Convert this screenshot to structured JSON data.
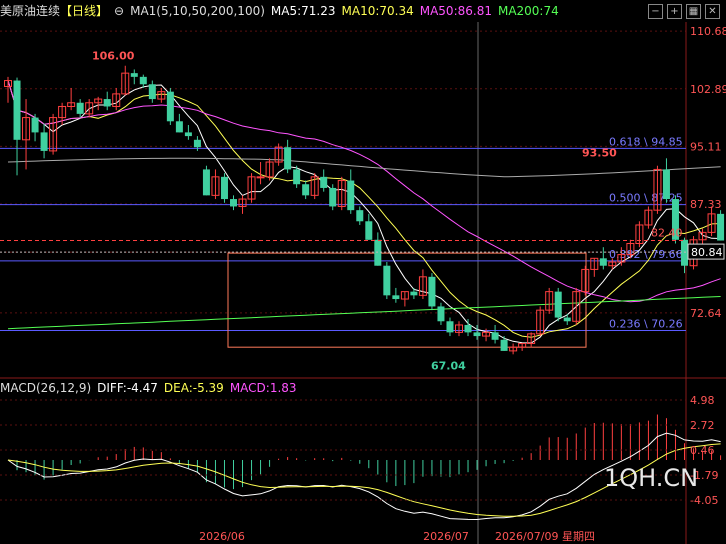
{
  "header": {
    "symbol": "美原油连续",
    "period": "【日线】",
    "ma_label": "MA1(5,10,50,200,100)",
    "ma5": "MA5:71.23",
    "ma10": "MA10:70.34",
    "ma50": "MA50:86.81",
    "ma200": "MA200:74",
    "colors": {
      "ma5": "#ffffff",
      "ma10": "#ffff55",
      "ma50": "#ff55ff",
      "ma200": "#55ff55"
    }
  },
  "toolbar": {
    "icons": [
      "minus-icon",
      "plus-icon",
      "grid-icon",
      "close-icon"
    ],
    "glyphs": [
      "−",
      "+",
      "▦",
      "✕"
    ]
  },
  "macd_header": {
    "label": "MACD(26,12,9)",
    "diff": "DIFF:-4.47",
    "dea": "DEA:-5.39",
    "macd": "MACD:1.83"
  },
  "watermark": "1QH.CN",
  "chart_data": {
    "type": "candlestick",
    "y_ticks": [
      "110.68",
      "102.89",
      "95.11",
      "87.33",
      "80.84",
      "72.64"
    ],
    "ylim": [
      66.0,
      111.5
    ],
    "x_ticks": [
      "2026/06",
      "2026/07",
      "2026/07/09 星期四"
    ],
    "annotations": {
      "high_label": "106.00",
      "low_label": "67.04",
      "recent_high_label": "93.50",
      "price_line": "82.40",
      "current_price": "80.84"
    },
    "fib_levels": [
      {
        "label": "0.618 \\ 94.85",
        "value": 94.85
      },
      {
        "label": "0.500 \\ 87.25",
        "value": 87.25
      },
      {
        "label": "0.382 \\ 79.66",
        "value": 79.66
      },
      {
        "label": "0.236 \\ 70.26",
        "value": 70.26
      }
    ],
    "rect_box": {
      "y_top": 80.7,
      "y_bottom": 68.0
    },
    "candles": [
      [
        103.2,
        104.5,
        101.0,
        104.0
      ],
      [
        104.0,
        104.4,
        91.2,
        96.0
      ],
      [
        96.0,
        101.5,
        92.0,
        99.0
      ],
      [
        99.0,
        99.5,
        95.8,
        97.0
      ],
      [
        97.0,
        98.2,
        93.5,
        94.5
      ],
      [
        94.5,
        99.5,
        94.0,
        99.0
      ],
      [
        99.0,
        101.0,
        98.0,
        100.5
      ],
      [
        100.5,
        103.0,
        100.0,
        101.0
      ],
      [
        101.0,
        101.5,
        99.0,
        99.5
      ],
      [
        99.5,
        101.5,
        99.0,
        101.0
      ],
      [
        101.0,
        101.8,
        100.0,
        101.5
      ],
      [
        101.5,
        102.5,
        100.0,
        100.5
      ],
      [
        100.5,
        103.0,
        100.0,
        102.2
      ],
      [
        102.2,
        106.0,
        102.0,
        105.0
      ],
      [
        105.0,
        105.5,
        103.5,
        104.5
      ],
      [
        104.5,
        104.8,
        103.0,
        103.5
      ],
      [
        103.5,
        104.0,
        101.0,
        101.5
      ],
      [
        101.5,
        103.0,
        101.0,
        102.5
      ],
      [
        102.5,
        103.0,
        98.0,
        98.5
      ],
      [
        98.5,
        99.5,
        97.0,
        97.0
      ],
      [
        97.0,
        98.0,
        96.0,
        96.5
      ],
      [
        96.0,
        96.5,
        94.5,
        95.0
      ],
      [
        92.0,
        92.5,
        88.5,
        88.5
      ],
      [
        88.5,
        92.0,
        88.0,
        91.0
      ],
      [
        91.0,
        91.5,
        87.5,
        88.0
      ],
      [
        88.0,
        88.5,
        86.5,
        87.0
      ],
      [
        87.0,
        88.5,
        86.0,
        88.0
      ],
      [
        88.0,
        91.5,
        87.5,
        91.0
      ],
      [
        91.0,
        93.0,
        90.0,
        91.0
      ],
      [
        91.0,
        93.5,
        90.5,
        93.0
      ],
      [
        93.0,
        95.5,
        92.5,
        95.0
      ],
      [
        95.0,
        96.0,
        91.5,
        92.0
      ],
      [
        92.0,
        92.5,
        89.5,
        90.0
      ],
      [
        90.0,
        90.5,
        88.0,
        88.5
      ],
      [
        88.5,
        91.5,
        88.0,
        91.0
      ],
      [
        91.0,
        92.0,
        89.0,
        89.5
      ],
      [
        89.5,
        90.0,
        86.5,
        87.0
      ],
      [
        87.0,
        91.0,
        86.5,
        90.5
      ],
      [
        90.5,
        92.0,
        86.0,
        86.5
      ],
      [
        86.5,
        87.0,
        84.5,
        85.0
      ],
      [
        85.0,
        86.0,
        82.5,
        82.5
      ],
      [
        82.5,
        83.5,
        79.0,
        79.0
      ],
      [
        79.0,
        79.5,
        74.5,
        75.0
      ],
      [
        75.0,
        76.0,
        74.0,
        74.5
      ],
      [
        74.5,
        75.5,
        73.5,
        75.5
      ],
      [
        75.5,
        76.0,
        74.5,
        75.0
      ],
      [
        75.0,
        78.5,
        74.5,
        77.5
      ],
      [
        77.5,
        78.0,
        73.0,
        73.5
      ],
      [
        73.5,
        74.0,
        71.0,
        71.5
      ],
      [
        71.5,
        72.0,
        69.5,
        70.0
      ],
      [
        70.0,
        71.5,
        69.5,
        71.0
      ],
      [
        71.0,
        71.8,
        69.5,
        70.0
      ],
      [
        70.0,
        71.0,
        69.0,
        69.5
      ],
      [
        69.5,
        70.5,
        68.8,
        70.0
      ],
      [
        70.0,
        71.0,
        68.5,
        69.0
      ],
      [
        69.0,
        69.5,
        67.5,
        67.5
      ],
      [
        67.5,
        68.5,
        67.04,
        68.0
      ],
      [
        68.0,
        68.5,
        67.5,
        68.5
      ],
      [
        68.5,
        70.0,
        68.0,
        69.8
      ],
      [
        69.8,
        73.5,
        69.5,
        73.0
      ],
      [
        73.0,
        76.0,
        72.5,
        75.5
      ],
      [
        75.5,
        76.0,
        71.5,
        72.0
      ],
      [
        72.0,
        72.5,
        71.0,
        71.5
      ],
      [
        71.5,
        76.0,
        71.0,
        75.5
      ],
      [
        75.5,
        79.0,
        75.0,
        78.5
      ],
      [
        78.5,
        80.0,
        77.5,
        80.0
      ],
      [
        80.0,
        81.5,
        78.5,
        79.0
      ],
      [
        79.0,
        80.0,
        78.5,
        79.5
      ],
      [
        79.5,
        81.5,
        79.0,
        80.5
      ],
      [
        80.5,
        82.5,
        80.0,
        82.0
      ],
      [
        82.0,
        85.0,
        81.5,
        84.5
      ],
      [
        84.5,
        87.0,
        84.0,
        86.5
      ],
      [
        86.5,
        92.5,
        86.0,
        92.0
      ],
      [
        92.0,
        93.5,
        87.5,
        88.0
      ],
      [
        88.0,
        88.5,
        82.0,
        82.5
      ],
      [
        82.5,
        82.8,
        78.0,
        79.0
      ],
      [
        79.0,
        83.0,
        78.5,
        82.5
      ],
      [
        82.5,
        84.0,
        81.0,
        83.5
      ],
      [
        83.5,
        87.0,
        83.0,
        86.0
      ],
      [
        86.0,
        86.5,
        82.4,
        82.4
      ]
    ]
  }
}
